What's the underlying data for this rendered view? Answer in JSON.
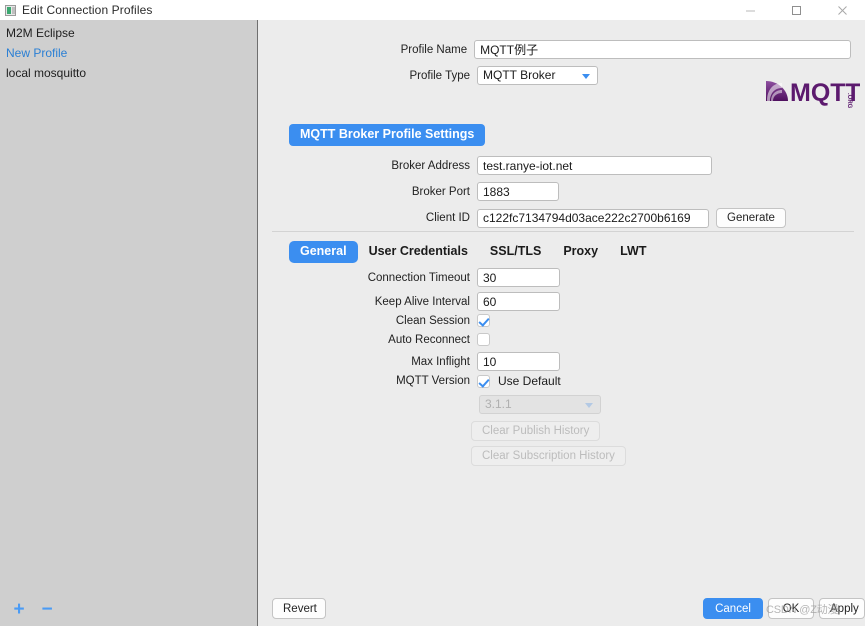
{
  "window": {
    "title": "Edit Connection Profiles",
    "icon": "app-icon",
    "controls": {
      "minimize": "–",
      "maximize": "□",
      "close": "✕"
    }
  },
  "sidebar": {
    "items": [
      {
        "label": "M2M Eclipse",
        "selected": false
      },
      {
        "label": "New Profile",
        "selected": true
      },
      {
        "label": "local mosquitto",
        "selected": false
      }
    ],
    "add_label": "+",
    "remove_label": "−"
  },
  "form": {
    "profile_name_label": "Profile Name",
    "profile_name_value": "MQTT例子",
    "profile_type_label": "Profile Type",
    "profile_type_value": "MQTT Broker",
    "logo_alt": "MQTT.org",
    "section_title": "MQTT Broker Profile Settings",
    "broker_address_label": "Broker Address",
    "broker_address_value": "test.ranye-iot.net",
    "broker_port_label": "Broker Port",
    "broker_port_value": "1883",
    "client_id_label": "Client ID",
    "client_id_value": "c122fc7134794d03ace222c2700b6169",
    "generate_label": "Generate"
  },
  "tabs": [
    {
      "label": "General",
      "active": true
    },
    {
      "label": "User Credentials",
      "active": false
    },
    {
      "label": "SSL/TLS",
      "active": false
    },
    {
      "label": "Proxy",
      "active": false
    },
    {
      "label": "LWT",
      "active": false
    }
  ],
  "general": {
    "connection_timeout_label": "Connection Timeout",
    "connection_timeout_value": "30",
    "keep_alive_label": "Keep Alive Interval",
    "keep_alive_value": "60",
    "clean_session_label": "Clean Session",
    "clean_session_checked": true,
    "auto_reconnect_label": "Auto Reconnect",
    "auto_reconnect_checked": false,
    "max_inflight_label": "Max Inflight",
    "max_inflight_value": "10",
    "mqtt_version_label": "MQTT Version",
    "use_default_label": "Use Default",
    "use_default_checked": true,
    "version_value": "3.1.1",
    "clear_publish_label": "Clear Publish History",
    "clear_subscription_label": "Clear Subscription History"
  },
  "footer": {
    "revert_label": "Revert",
    "cancel_label": "Cancel",
    "ok_label": "OK",
    "apply_label": "Apply"
  },
  "watermark": {
    "text": "CSDN @Z动漫"
  },
  "colors": {
    "accent": "#3b8ef0",
    "sidebar_bg": "#cfcfcf",
    "panel_bg": "#ececec",
    "selected_text": "#2a7fd4",
    "logo_purple": "#6a1b7a"
  }
}
